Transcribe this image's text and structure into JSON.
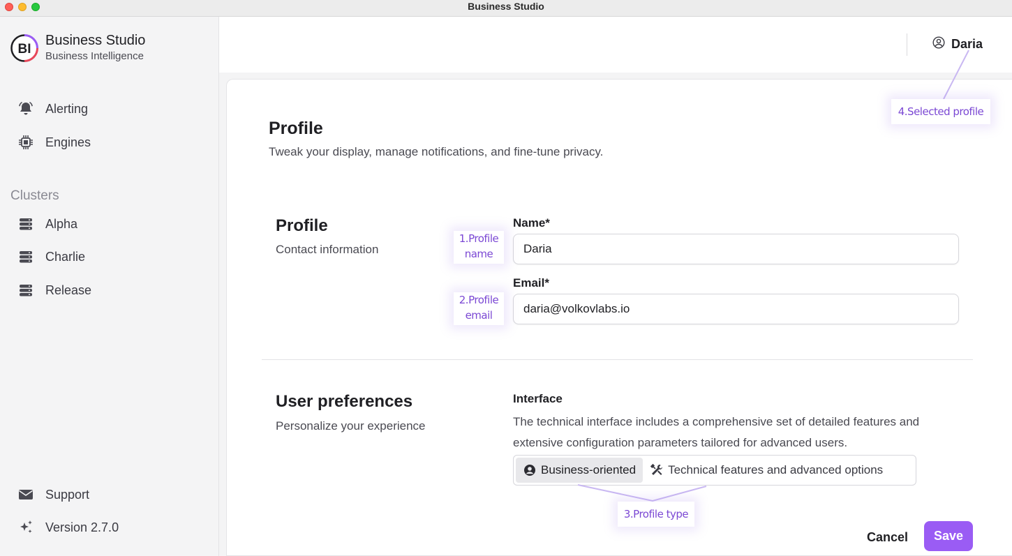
{
  "window": {
    "title": "Business Studio"
  },
  "brand": {
    "logo_text": "BI",
    "title": "Business Studio",
    "subtitle": "Business Intelligence"
  },
  "sidebar": {
    "items": [
      {
        "label": "Alerting",
        "icon": "bell-icon"
      },
      {
        "label": "Engines",
        "icon": "chip-icon"
      }
    ],
    "clusters_label": "Clusters",
    "clusters": [
      {
        "label": "Alpha",
        "icon": "server-stack-icon"
      },
      {
        "label": "Charlie",
        "icon": "server-stack-icon"
      },
      {
        "label": "Release",
        "icon": "server-stack-icon"
      }
    ],
    "footer": [
      {
        "label": "Support",
        "icon": "envelope-icon"
      },
      {
        "label": "Version 2.7.0",
        "icon": "sparkles-icon"
      }
    ]
  },
  "header": {
    "user_name": "Daria",
    "user_icon": "user-circle-icon"
  },
  "page": {
    "title": "Profile",
    "description": "Tweak your display, manage notifications, and fine-tune privacy."
  },
  "profile_section": {
    "title": "Profile",
    "description": "Contact information",
    "name_label": "Name*",
    "name_value": "Daria",
    "email_label": "Email*",
    "email_value": "daria@volkovlabs.io"
  },
  "preferences_section": {
    "title": "User preferences",
    "description": "Personalize your experience",
    "interface_label": "Interface",
    "interface_help": "The technical interface includes a comprehensive set of detailed features and extensive configuration parameters tailored for advanced users.",
    "options": [
      {
        "label": "Business-oriented",
        "icon": "user-circle-icon",
        "selected": true
      },
      {
        "label": "Technical features and advanced options",
        "icon": "wrench-screwdriver-icon",
        "selected": false
      }
    ]
  },
  "actions": {
    "cancel_label": "Cancel",
    "save_label": "Save"
  },
  "annotations": {
    "profile_name_1": "1.Profile",
    "profile_name_2": "name",
    "profile_email_1": "2.Profile",
    "profile_email_2": "email",
    "profile_type": "3.Profile type",
    "selected_profile": "4.Selected profile"
  },
  "colors": {
    "accent": "#9a5cf4",
    "annotation": "#7b48d4",
    "logo_ring": "#e8475a"
  }
}
